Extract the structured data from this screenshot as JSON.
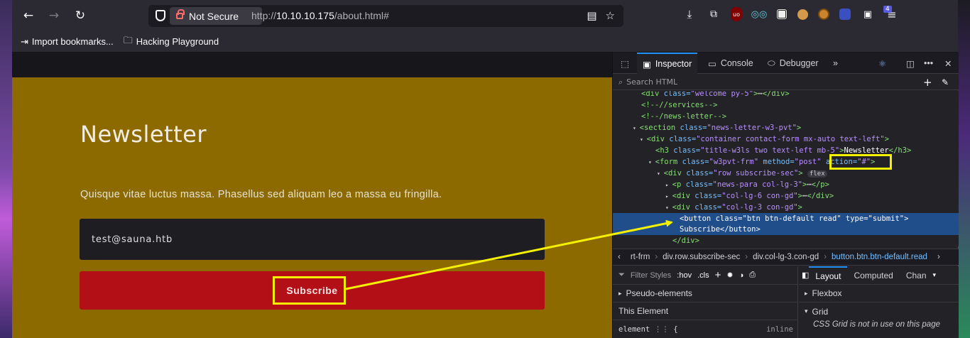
{
  "browser": {
    "security_label": "Not Secure",
    "url_prefix": "http://",
    "url_host": "10.10.10.175",
    "url_path": "/about.html#",
    "extension_badge": "4"
  },
  "bookmarks": {
    "items": [
      {
        "label": "Import bookmarks..."
      },
      {
        "label": "Hacking Playground"
      }
    ]
  },
  "page": {
    "title": "Newsletter",
    "text": "Quisque vitae luctus massa. Phasellus sed aliquam leo a massa eu fringilla.",
    "email_value": "test@sauna.htb",
    "subscribe_label": "Subscribe"
  },
  "devtools": {
    "tabs": [
      "Inspector",
      "Console",
      "Debugger"
    ],
    "search_placeholder": "Search HTML",
    "dom_lines": [
      {
        "tag": "<div ",
        "attr": "class=",
        "val": "\"welcome py-5\"",
        "rest": ">",
        "tail": "</div>"
      },
      {
        "comment": "<!--//services-->"
      },
      {
        "comment": "<!--/news-letter-->"
      },
      {
        "tag": "<section ",
        "attr": "class=",
        "val": "\"news-letter-w3-pvt\"",
        "rest": ">"
      },
      {
        "tag": "<div ",
        "attr": "class=",
        "val": "\"container contact-form mx-auto text-left\"",
        "rest": ">"
      },
      {
        "tag": "<h3 ",
        "attr": "class=",
        "val": "\"title-w3ls two text-left mb-5\"",
        "rest": ">",
        "text": "Newsletter",
        "tail": "</h3>"
      },
      {
        "tag": "<form ",
        "attr": "class=",
        "val": "\"w3pvt-frm\"",
        "attr2": " method=",
        "val2": "\"post\"",
        "attr3": " action=",
        "val3": "\"#\"",
        "rest": ">"
      },
      {
        "tag": "<div ",
        "attr": "class=",
        "val": "\"row subscribe-sec\"",
        "rest": ">",
        "badge": "flex"
      },
      {
        "tag": "<p ",
        "attr": "class=",
        "val": "\"news-para col-lg-3\"",
        "rest": ">",
        "tail": "</p>"
      },
      {
        "tag": "<div ",
        "attr": "class=",
        "val": "\"col-lg-6 con-gd\"",
        "rest": ">",
        "tail": "</div>"
      },
      {
        "tag": "<div ",
        "attr": "class=",
        "val": "\"col-lg-3 con-gd\"",
        "rest": ">"
      },
      {
        "tag": "<button ",
        "attr": "class=",
        "val": "\"btn btn-default read\"",
        "attr2": " type=",
        "val2": "\"submit\"",
        "rest": ">",
        "line2": "Subscribe</button>"
      },
      {
        "tag": "</div>"
      }
    ],
    "breadcrumbs": [
      "rt-frm",
      "div.row.subscribe-sec",
      "div.col-lg-3.con-gd",
      "button.btn.btn-default.read"
    ],
    "rules": {
      "filter_placeholder": "Filter Styles",
      "hov": ":hov",
      "cls": ".cls",
      "pseudo_elements": "Pseudo-elements",
      "this_element": "This Element",
      "element_rule": "element",
      "brace": "{",
      "inline": "inline"
    },
    "layout": {
      "tabs": [
        "Layout",
        "Computed",
        "Chan"
      ],
      "flexbox": "Flexbox",
      "grid": "Grid",
      "grid_note": "CSS Grid is not in use on this page"
    }
  },
  "colors": {
    "highlight": "#f4f000",
    "page_bg": "#8c6a00",
    "subscribe_bg": "#b30f16",
    "selected_row": "#204e8a"
  }
}
